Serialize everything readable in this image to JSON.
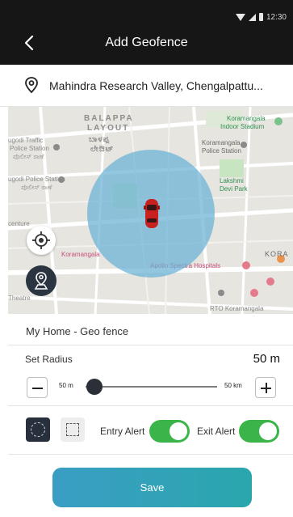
{
  "status_bar": {
    "time": "12:30",
    "icons": [
      "wifi-icon",
      "signal-icon",
      "battery-icon"
    ]
  },
  "header": {
    "title": "Add Geofence",
    "back_icon": "back-arrow-icon"
  },
  "address": {
    "icon": "location-pin-icon",
    "text": "Mahindra Research Valley, Chengalpattu..."
  },
  "map": {
    "labels": {
      "balappa": "BALAPPA",
      "layout": "LAYOUT",
      "balappa_kn": "ಬಾಳಪ್ಪ",
      "layout_kn": "ಲೇಔಟ್",
      "traffic": "ugodi Traffic",
      "police_station": "Police Station",
      "station_kn": "ಪೊಲೀಸ್ ಠಾಣೆ",
      "police_station_2": "ugodi Police Station",
      "station_kn_2": "ಪೊಲೀಸ್ ಠಾಣೆ",
      "stadium": "Koramangala",
      "stadium_2": "Indoor Stadium",
      "kor_police": "Koramangala",
      "kor_police_2": "Police Station",
      "lakshmi": "Lakshmi",
      "devi_park": "Devi Park",
      "centure": "centure",
      "koramangala": "Koramangala",
      "kora": "KORA",
      "apollo": "Apollo Spectra Hospitals",
      "theatre": "Theatre",
      "rto": "RTO Koramangala"
    },
    "fence_color": "#6ab2d6",
    "vehicle_icon": "red-car-icon",
    "buttons": {
      "locate_icon": "crosshair-locate-icon",
      "person_icon": "person-pin-icon"
    }
  },
  "form": {
    "fence_name": "My Home - Geo fence",
    "radius_label": "Set Radius",
    "radius_value": "50 m",
    "slider": {
      "min_label": "50 m",
      "max_label": "50 km",
      "fraction": 0.07
    },
    "shape_options": [
      "circle-shape-icon",
      "rectangle-shape-icon"
    ],
    "selected_shape": "circle",
    "entry_alert_label": "Entry Alert",
    "entry_alert_on": true,
    "exit_alert_label": "Exit Alert",
    "exit_alert_on": true,
    "toggle_color": "#3bb54a",
    "save_label": "Save"
  }
}
